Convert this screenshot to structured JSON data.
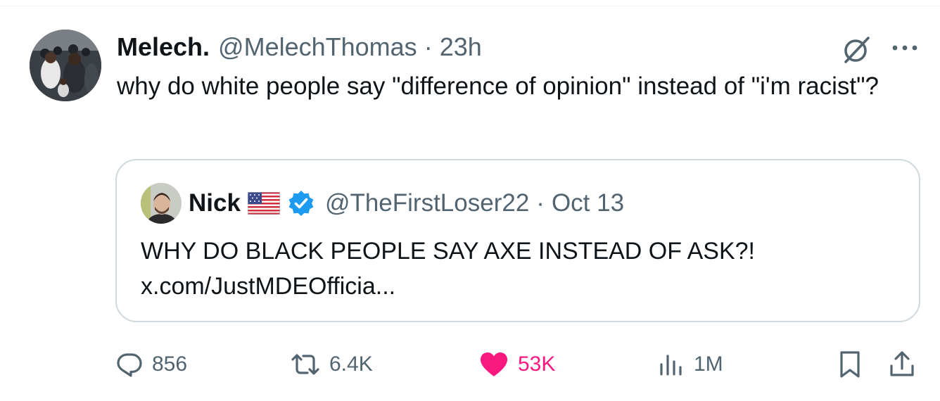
{
  "tweet": {
    "author": {
      "display_name": "Melech.",
      "handle": "@MelechThomas",
      "separator": "·",
      "time": "23h"
    },
    "text": "why do white people say \"difference of opinion\" instead of \"i'm racist\"?",
    "icons": {
      "grok": "grok-slash-circle-icon",
      "more": "more-dots-icon"
    }
  },
  "quote": {
    "author": {
      "display_name": "Nick",
      "flag": "us-flag-icon",
      "verified": "verified-badge-icon",
      "handle": "@TheFirstLoser22",
      "separator": "·",
      "time": "Oct 13"
    },
    "text": "WHY DO BLACK PEOPLE SAY AXE INSTEAD OF ASK?!",
    "link": "x.com/JustMDEOfficia..."
  },
  "actions": {
    "replies": "856",
    "reposts": "6.4K",
    "likes": "53K",
    "views": "1M",
    "bookmark_icon": "bookmark-icon",
    "share_icon": "share-icon"
  },
  "colors": {
    "text_primary": "#0f1419",
    "text_secondary": "#536471",
    "like_pink": "#f91880",
    "verified_blue": "#1d9bf0",
    "border": "#cfd9de"
  }
}
